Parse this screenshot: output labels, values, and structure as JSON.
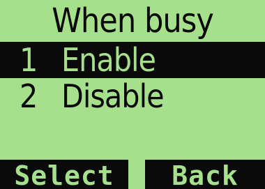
{
  "screen": {
    "title": "When busy"
  },
  "menu": {
    "items": [
      {
        "number": "1",
        "label": "Enable",
        "selected": true
      },
      {
        "number": "2",
        "label": "Disable",
        "selected": false
      }
    ]
  },
  "softkeys": {
    "left_label": "Select",
    "right_label": "Back"
  },
  "colors": {
    "background": "#a6e08c",
    "foreground": "#0a0a0a"
  }
}
